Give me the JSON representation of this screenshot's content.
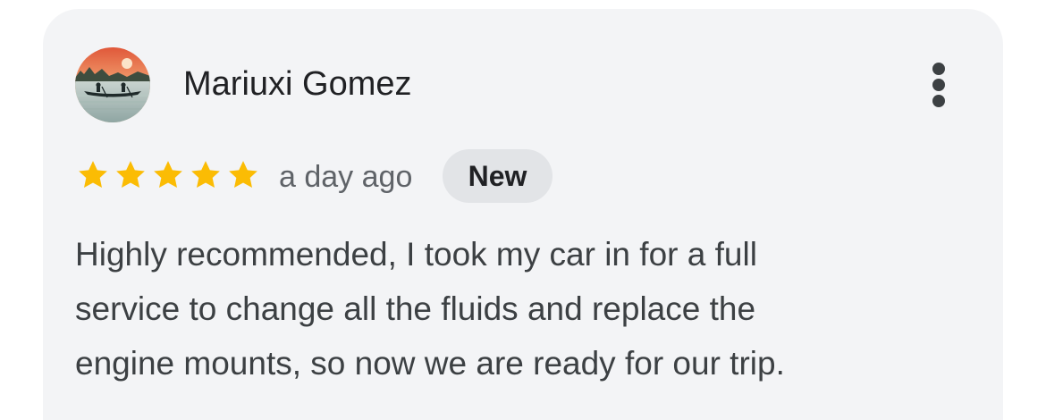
{
  "review": {
    "reviewer_name": "Mariuxi Gomez",
    "avatar": "avatar-canoe-sunset",
    "rating": 5,
    "rating_max": 5,
    "time_ago": "a day ago",
    "badge": "New",
    "text_lines": [
      "Highly recommended, I took my car in for a full",
      "service to change all the fluids and replace the",
      "engine mounts, so now we are ready for our trip."
    ],
    "more_icon": "more-vert-icon",
    "star_icon": "star-icon"
  },
  "colors": {
    "card_bg": "#f3f4f6",
    "star": "#fbbc04",
    "badge_bg": "#e2e4e7",
    "text_primary": "#202124",
    "text_secondary": "#5f6368",
    "text_body": "#3c4043"
  }
}
